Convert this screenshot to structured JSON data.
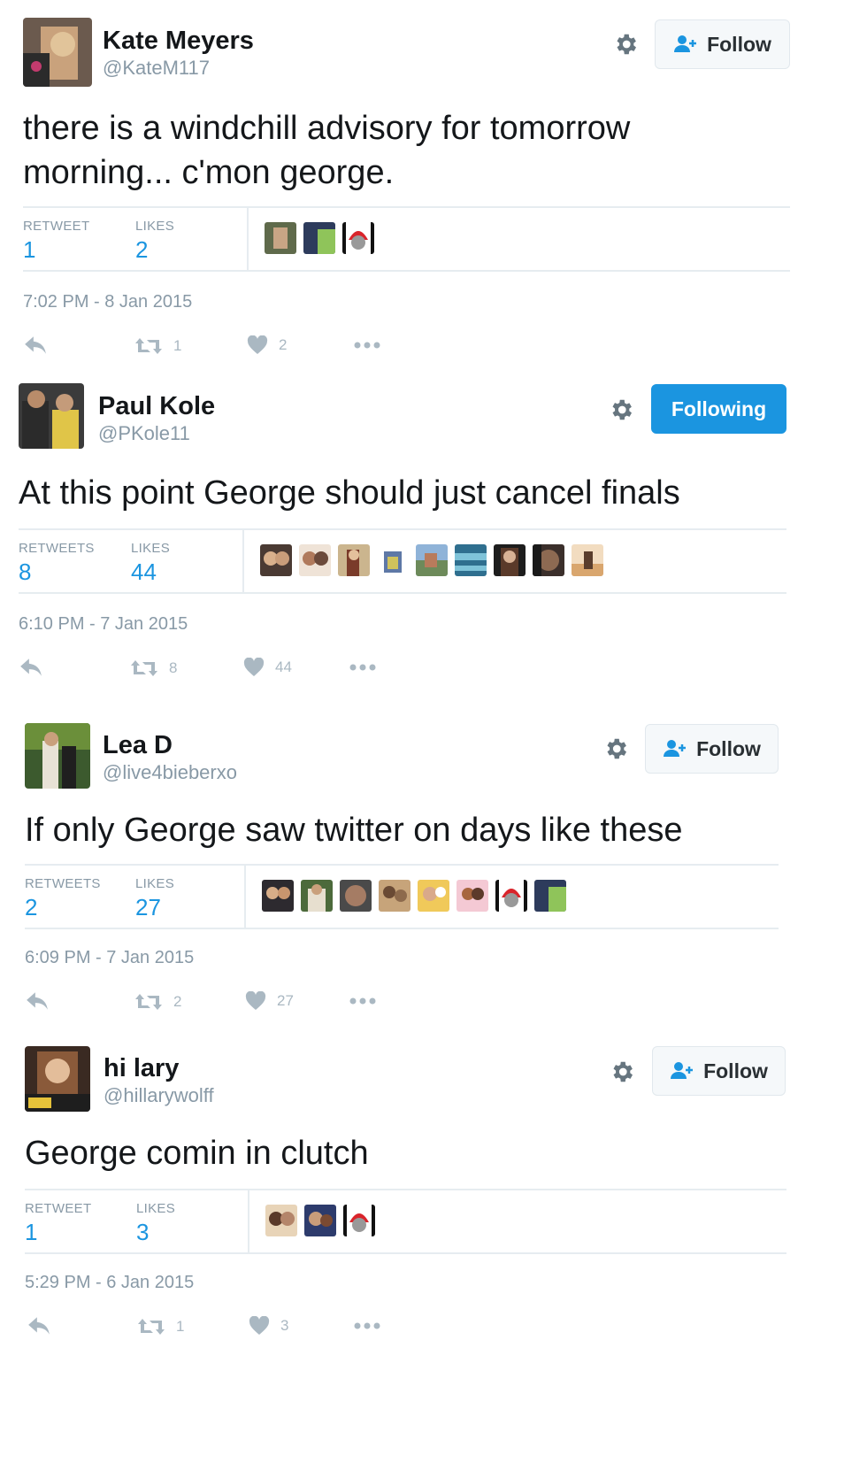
{
  "colors": {
    "blue": "#1b95e0",
    "gray": "#8899a6",
    "icon_gray": "#aab8c2"
  },
  "tweets": [
    {
      "name": "Kate Meyers",
      "handle": "@KateM117",
      "button": {
        "label": "Follow",
        "state": "follow",
        "icon": "follow-user-icon"
      },
      "text": "there is a windchill advisory for tomorrow morning... c'mon george.",
      "stats": [
        {
          "label": "RETWEET",
          "value": "1"
        },
        {
          "label": "LIKES",
          "value": "2"
        }
      ],
      "liker_count": 3,
      "timestamp": "7:02 PM - 8 Jan 2015",
      "actions": {
        "retweets": "1",
        "likes": "2"
      }
    },
    {
      "name": "Paul Kole",
      "handle": "@PKole11",
      "button": {
        "label": "Following",
        "state": "following"
      },
      "text": "At this point George should just cancel finals",
      "stats": [
        {
          "label": "RETWEETS",
          "value": "8"
        },
        {
          "label": "LIKES",
          "value": "44"
        }
      ],
      "liker_count": 9,
      "timestamp": "6:10 PM - 7 Jan 2015",
      "actions": {
        "retweets": "8",
        "likes": "44"
      }
    },
    {
      "name": "Lea D",
      "handle": "@live4bieberxo",
      "button": {
        "label": "Follow",
        "state": "follow",
        "icon": "follow-user-icon"
      },
      "text": "If only George saw twitter on days like these",
      "stats": [
        {
          "label": "RETWEETS",
          "value": "2"
        },
        {
          "label": "LIKES",
          "value": "27"
        }
      ],
      "liker_count": 8,
      "timestamp": "6:09 PM - 7 Jan 2015",
      "actions": {
        "retweets": "2",
        "likes": "27"
      }
    },
    {
      "name": "hi lary",
      "handle": "@hillarywolff",
      "button": {
        "label": "Follow",
        "state": "follow",
        "icon": "follow-user-icon"
      },
      "text": "George comin in clutch",
      "stats": [
        {
          "label": "RETWEET",
          "value": "1"
        },
        {
          "label": "LIKES",
          "value": "3"
        }
      ],
      "liker_count": 3,
      "timestamp": "5:29 PM - 6 Jan 2015",
      "actions": {
        "retweets": "1",
        "likes": "3"
      }
    }
  ]
}
